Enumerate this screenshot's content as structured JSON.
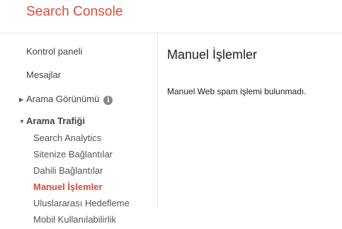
{
  "header": {
    "brand": "Search Console"
  },
  "sidebar": {
    "items": [
      {
        "label": "Kontrol paneli"
      },
      {
        "label": "Mesajlar"
      },
      {
        "label": "Arama Görünümü",
        "caret": "▶",
        "info_icon": "i"
      },
      {
        "label": "Arama Trafiği",
        "caret": "▼"
      }
    ],
    "subitems": [
      {
        "label": "Search Analytics"
      },
      {
        "label": "Sitenize Bağlantılar"
      },
      {
        "label": "Dahili Bağlantılar"
      },
      {
        "label": "Manuel İşlemler",
        "active": true
      },
      {
        "label": "Uluslararası Hedefleme"
      },
      {
        "label": "Mobil Kullanılabilirlik"
      }
    ]
  },
  "main": {
    "title": "Manuel İşlemler",
    "message": "Manuel Web spam işlemi bulunmadı."
  },
  "colors": {
    "brand": "#dd4b39",
    "active": "#dd4b39",
    "divider": "#e5e5e5"
  }
}
